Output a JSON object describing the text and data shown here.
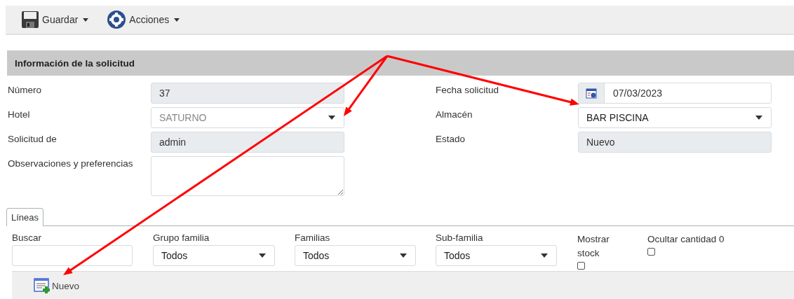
{
  "toolbar": [
    {
      "label": "Guardar",
      "kind": "save"
    },
    {
      "label": "Acciones",
      "kind": "gear"
    }
  ],
  "section": {
    "title": "Información de la solicitud"
  },
  "fields_left": [
    {
      "label": "Número",
      "kind": "readonly",
      "value": "37"
    },
    {
      "label": "Hotel",
      "kind": "select",
      "value": "SATURNO",
      "disabled": true
    },
    {
      "label": "Solicitud de",
      "kind": "readonly",
      "value": "admin"
    },
    {
      "label": "Observaciones y preferencias",
      "kind": "textarea"
    }
  ],
  "fields_right": [
    {
      "label": "Fecha solicitud",
      "kind": "date",
      "value": "07/03/2023"
    },
    {
      "label": "Almacén",
      "kind": "select",
      "value": "BAR PISCINA",
      "disabled": false
    },
    {
      "label": "Estado",
      "kind": "readonly",
      "value": "Nuevo"
    }
  ],
  "tabs": [
    {
      "label": "Líneas",
      "selected": true
    }
  ],
  "filters": [
    {
      "label": "Buscar",
      "kind": "text"
    },
    {
      "label": "Grupo familia",
      "kind": "select",
      "value": "Todos"
    },
    {
      "label": "Familias",
      "kind": "select",
      "value": "Todos"
    },
    {
      "label": "Sub-familia",
      "kind": "select",
      "value": "Todos"
    },
    {
      "label": "Mostrar stock",
      "kind": "checkbox",
      "checked": false
    },
    {
      "label": "Ocultar cantidad 0",
      "kind": "checkbox",
      "checked": false
    }
  ],
  "actions": [
    {
      "label": "Nuevo",
      "kind": "new"
    }
  ]
}
